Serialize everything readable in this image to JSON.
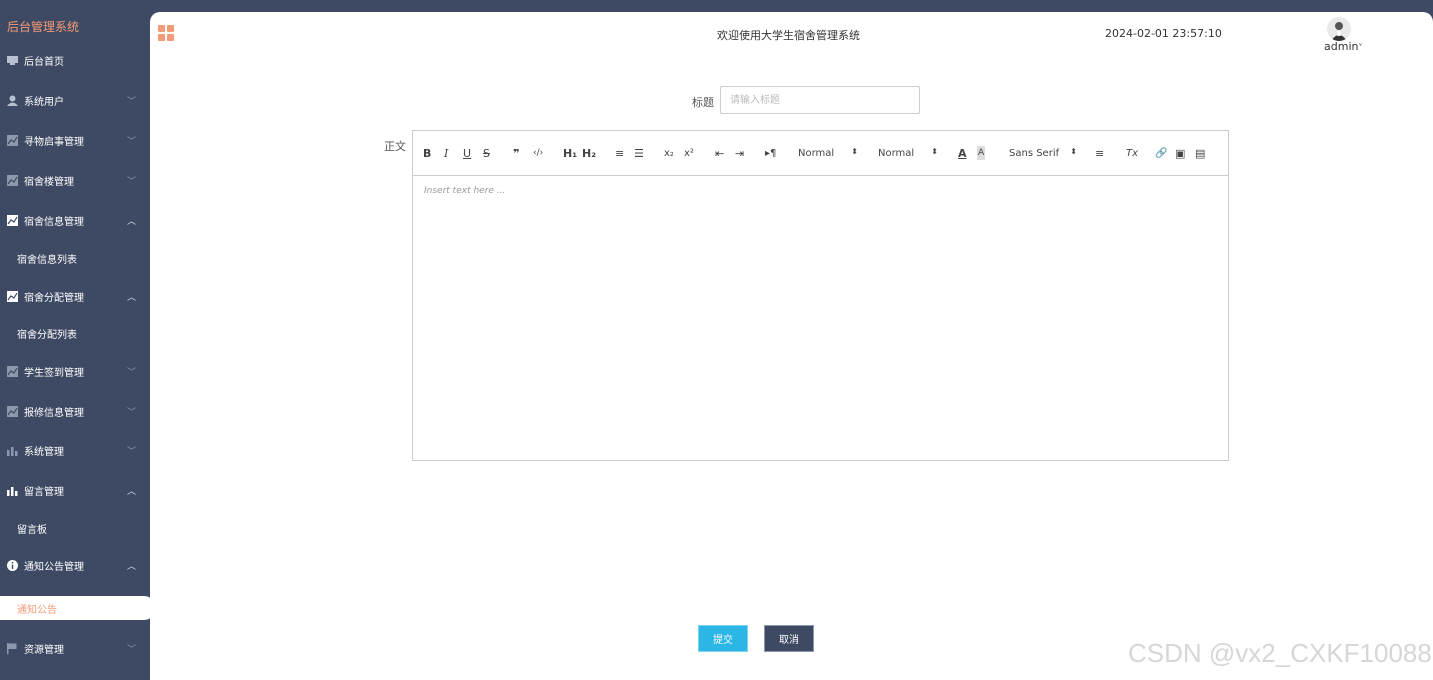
{
  "sidebar": {
    "brand": "后台管理系统",
    "items": [
      {
        "label": "后台首页",
        "icon": "monitor-icon",
        "arrow": ""
      },
      {
        "label": "系统用户",
        "icon": "user-icon",
        "arrow": "chevron-down"
      },
      {
        "label": "寻物启事管理",
        "icon": "chart-icon",
        "arrow": "chevron-down"
      },
      {
        "label": "宿舍楼管理",
        "icon": "chart-icon",
        "arrow": "chevron-down"
      },
      {
        "label": "宿舍信息管理",
        "icon": "chart-icon",
        "arrow": "chevron-up"
      },
      {
        "label": "宿舍分配管理",
        "icon": "chart-icon",
        "arrow": "chevron-up"
      },
      {
        "label": "学生签到管理",
        "icon": "chart-icon",
        "arrow": "chevron-down"
      },
      {
        "label": "报修信息管理",
        "icon": "chart-icon",
        "arrow": "chevron-down"
      },
      {
        "label": "系统管理",
        "icon": "bar-chart-icon",
        "arrow": "chevron-down"
      },
      {
        "label": "留言管理",
        "icon": "bar-chart-icon",
        "arrow": "chevron-up"
      },
      {
        "label": "通知公告管理",
        "icon": "info-icon",
        "arrow": "chevron-up"
      },
      {
        "label": "资源管理",
        "icon": "flag-icon",
        "arrow": "chevron-down"
      }
    ],
    "subs": {
      "dorm_info_list": "宿舍信息列表",
      "dorm_assign_list": "宿舍分配列表",
      "message_board": "留言板",
      "notice": "通知公告"
    }
  },
  "header": {
    "welcome": "欢迎使用大学生宿舍管理系统",
    "datetime": "2024-02-01 23:57:10",
    "user": "admin"
  },
  "form": {
    "title_label": "标题",
    "title_placeholder": "请输入标题",
    "title_value": "",
    "body_label": "正文",
    "editor_placeholder": "Insert text here ...",
    "toolbar": {
      "bold": "B",
      "italic": "I",
      "underline": "U",
      "strike": "S",
      "blockquote": "❞",
      "code": "‹/›",
      "h1": "H₁",
      "h2": "H₂",
      "ordered": "≡",
      "bullet": "☰",
      "sub": "x₂",
      "sup": "x²",
      "outdent": "⇤",
      "indent": "⇥",
      "direction": "▸¶",
      "size_select": "Normal",
      "header_select": "Normal",
      "font_select": "Sans Serif",
      "color": "A",
      "background": "A",
      "align": "≡",
      "clean": "Tx",
      "link": "🔗",
      "image": "▣",
      "video": "▤"
    },
    "submit": "提交",
    "cancel": "取消"
  },
  "watermark": "CSDN @vx2_CXKF10088",
  "colors": {
    "sidebar_bg": "#3e4a63",
    "accent": "#f39a76",
    "submit": "#2bb6e6"
  }
}
